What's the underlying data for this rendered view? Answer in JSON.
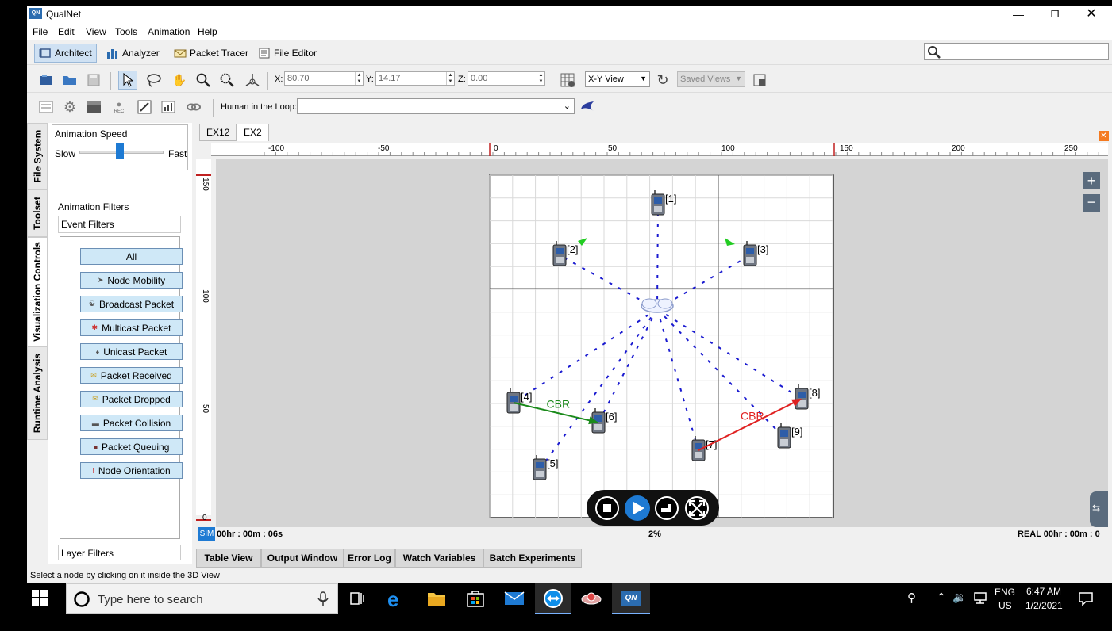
{
  "window": {
    "app_icon_text": "QN",
    "title": "QualNet"
  },
  "menu": [
    "File",
    "Edit",
    "View",
    "Tools",
    "Animation",
    "Help"
  ],
  "modes": [
    {
      "label": "Architect",
      "active": true,
      "icon": "architect-icon"
    },
    {
      "label": "Analyzer",
      "active": false,
      "icon": "bar-chart-icon"
    },
    {
      "label": "Packet Tracer",
      "active": false,
      "icon": "envelope-icon"
    },
    {
      "label": "File Editor",
      "active": false,
      "icon": "document-icon"
    }
  ],
  "coords": {
    "x_label": "X:",
    "x_value": "80.70",
    "y_label": "Y:",
    "y_value": "14.17",
    "z_label": "Z:",
    "z_value": "0.00"
  },
  "view_select": "X-Y View",
  "saved_views": "Saved Views",
  "human_in_loop_label": "Human in the Loop:",
  "side_tabs": [
    "File System",
    "Toolset",
    "Visualization Controls",
    "Runtime Analysis"
  ],
  "animation": {
    "speed_title": "Animation Speed",
    "slow": "Slow",
    "fast": "Fast",
    "filters_title": "Animation Filters",
    "event_filters": "Event Filters",
    "layer_filters": "Layer Filters",
    "buttons": [
      {
        "label": "All",
        "icon": ""
      },
      {
        "label": "Node Mobility",
        "icon": "mobility-icon"
      },
      {
        "label": "Broadcast Packet",
        "icon": "broadcast-icon"
      },
      {
        "label": "Multicast Packet",
        "icon": "multicast-icon"
      },
      {
        "label": "Unicast Packet",
        "icon": "unicast-icon"
      },
      {
        "label": "Packet Received",
        "icon": "received-icon"
      },
      {
        "label": "Packet Dropped",
        "icon": "dropped-icon"
      },
      {
        "label": "Packet Collision",
        "icon": "collision-icon"
      },
      {
        "label": "Packet Queuing",
        "icon": "queue-icon"
      },
      {
        "label": "Node Orientation",
        "icon": "orientation-icon"
      }
    ]
  },
  "doc_tabs": [
    {
      "label": "EX12",
      "active": false
    },
    {
      "label": "EX2",
      "active": true
    }
  ],
  "ruler_top": [
    "-100",
    "-50",
    "0",
    "50",
    "100",
    "150",
    "200",
    "250"
  ],
  "ruler_left": [
    "150",
    "100",
    "50",
    "0"
  ],
  "nodes": [
    "[1]",
    "[2]",
    "[3]",
    "[4]",
    "[5]",
    "[6]",
    "[7]",
    "[8]",
    "[9]"
  ],
  "links": [
    {
      "label": "CBR",
      "from": "[4]",
      "to": "[6]",
      "color": "#1a8a1a"
    },
    {
      "label": "CBR",
      "from": "[7]",
      "to": "[8]",
      "color": "#e02020"
    }
  ],
  "sim": {
    "badge": "SIM",
    "sim_time": "00hr : 00m : 06s",
    "progress": "2%",
    "real_time": "REAL 00hr : 00m : 0"
  },
  "bottom_tabs": [
    "Table View",
    "Output Window",
    "Error Log",
    "Watch Variables",
    "Batch Experiments"
  ],
  "status_text": "Select a node by clicking on it inside the 3D View",
  "taskbar": {
    "search_placeholder": "Type here to search",
    "lang": "ENG",
    "region": "US",
    "time": "6:47 AM",
    "date": "1/2/2021"
  }
}
